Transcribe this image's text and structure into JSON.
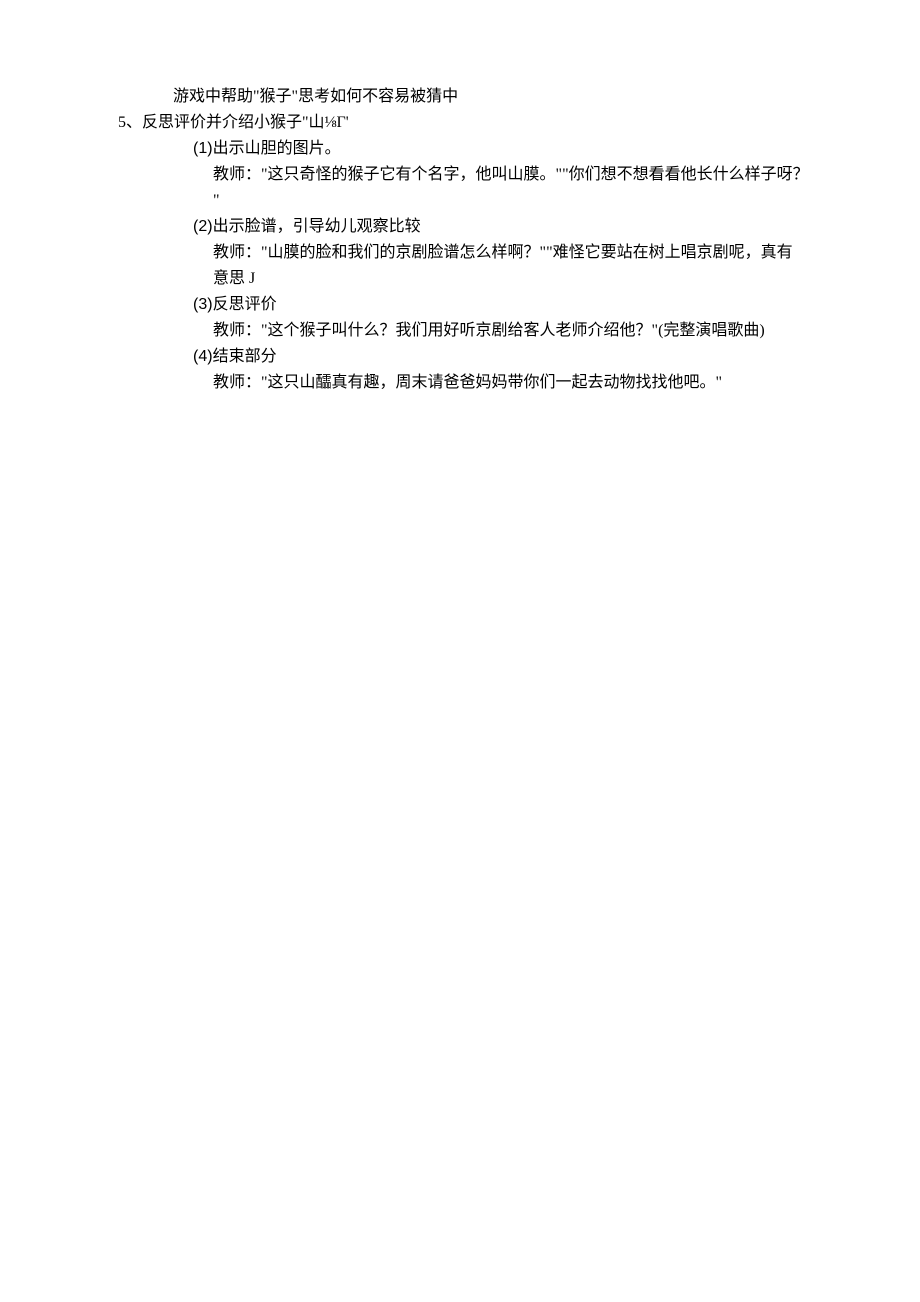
{
  "lines": {
    "l1": "游戏中帮助\"猴子\"思考如何不容易被猜中",
    "l2": "5、反思评价并介绍小猴子\"山⅛Γ'",
    "l3_prefix": "(1)",
    "l3_text": "出示山胆的图片。",
    "l4": "教师：\"这只奇怪的猴子它有个名字，他叫山膜。\"\"你们想不想看看他长什么样子呀？",
    "l5": "\"",
    "l6_prefix": "(2)",
    "l6_text": "出示脸谱，引导幼儿观察比较",
    "l7": "教师：\"山膜的脸和我们的京剧脸谱怎么样啊？\"\"难怪它要站在树上唱京剧呢，真有",
    "l8": "意思 J",
    "l9_prefix": "(3)",
    "l9_text": "反思评价",
    "l10": "教师：\"这个猴子叫什么？我们用好听京剧给客人老师介绍他？\"(完整演唱歌曲)",
    "l11_prefix": "(4)",
    "l11_text": "结束部分",
    "l12": "教师：\"这只山醽真有趣，周末请爸爸妈妈带你们一起去动物找找他吧。\""
  }
}
